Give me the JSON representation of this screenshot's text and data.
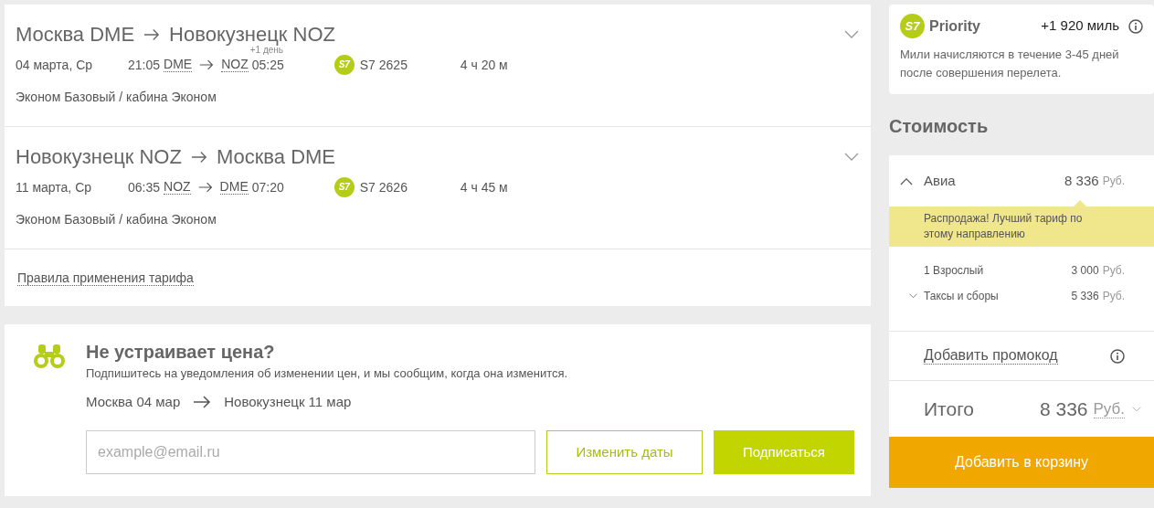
{
  "flights": [
    {
      "from": "Москва DME",
      "to": "Новокузнецк NOZ",
      "date": "04 марта, Ср",
      "dep_time": "21:05",
      "dep_airport": "DME",
      "arr_airport": "NOZ",
      "arr_time": "05:25",
      "day_note": "+1 день",
      "airline": "S7",
      "flight": "S7 2625",
      "duration": "4 ч 20 м",
      "fare": "Эконом Базовый / кабина Эконом",
      "expanded": false
    },
    {
      "from": "Новокузнецк NOZ",
      "to": "Москва DME",
      "date": "11 марта, Ср",
      "dep_time": "06:35",
      "dep_airport": "NOZ",
      "arr_airport": "DME",
      "arr_time": "07:20",
      "airline": "S7",
      "flight": "S7 2626",
      "duration": "4 ч 45 м",
      "fare": "Эконом Базовый / кабина Эконом",
      "expanded": false
    }
  ],
  "fare_rules_link": "Правила применения тарифа",
  "subscribe": {
    "title": "Не устраивает цена?",
    "text": "Подпишитесь на уведомления об изменении цен, и мы сообщим, когда она изменится.",
    "from": "Москва 04 мар",
    "to": "Новокузнецк 11 мар",
    "email": {
      "placeholder": "example@email.ru"
    },
    "change_dates_button": "Изменить даты",
    "subscribe_button": "Подписаться"
  },
  "priority": {
    "logo": "S7",
    "brand": "Priority",
    "miles": "+1 920 миль",
    "note": "Мили начисляются в течение 3-45 дней после совершения перелета."
  },
  "cost": {
    "title": "Стоимость",
    "avia": {
      "label": "Авиа",
      "amount": "8 336",
      "currency": "Руб.",
      "expanded": true
    },
    "sale_note": "Распродажа! Лучший тариф по этому направлению",
    "items": [
      {
        "kind": "plain",
        "label": "1 Взрослый",
        "amount": "3 000",
        "currency": "Руб."
      },
      {
        "kind": "expandable",
        "label": "Таксы и сборы",
        "amount": "5 336",
        "currency": "Руб.",
        "expanded": false
      }
    ],
    "promo_link": "Добавить промокод",
    "total": {
      "label": "Итого",
      "amount": "8 336",
      "currency": "Руб."
    },
    "cart_button": "Добавить в корзину"
  }
}
